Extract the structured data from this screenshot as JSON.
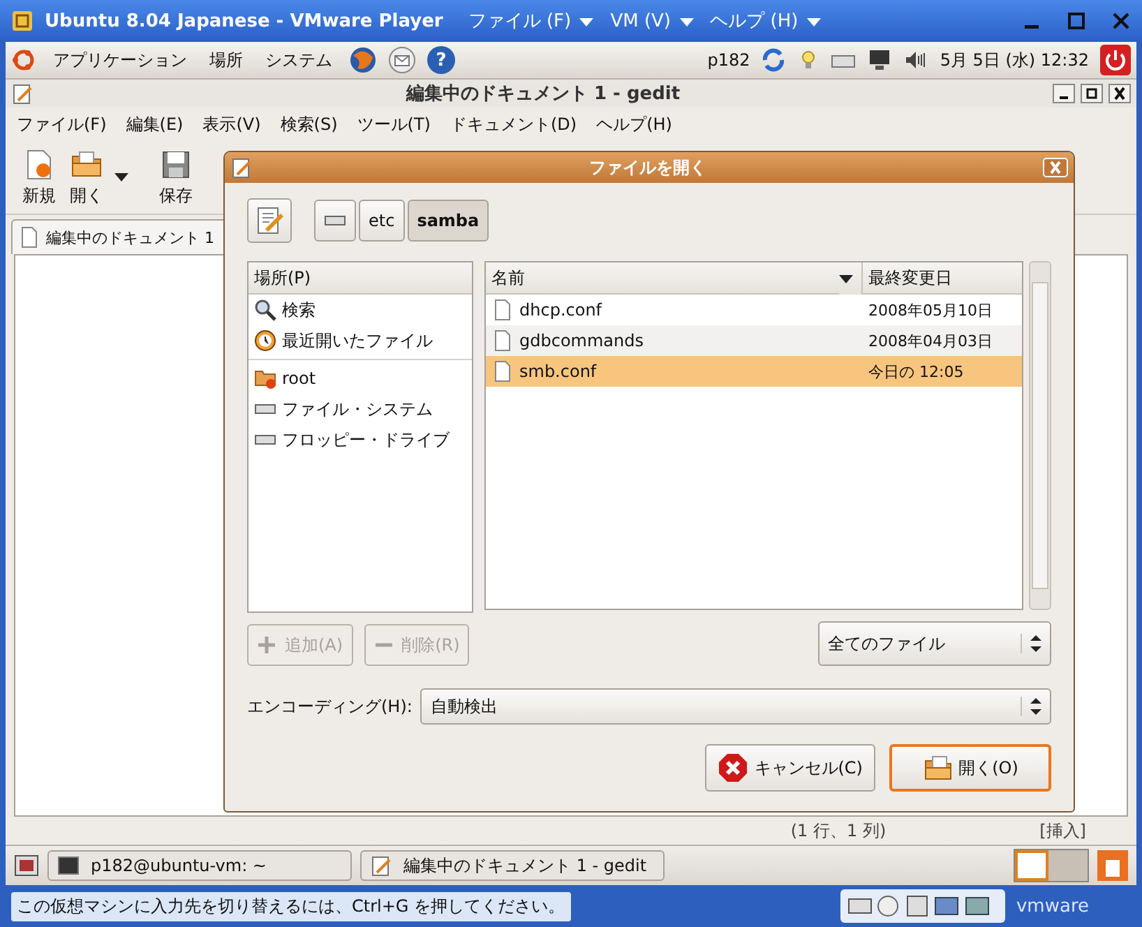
{
  "vm_window": {
    "title": "Ubuntu 8.04 Japanese - VMware Player",
    "menus": [
      "ファイル (F)",
      "VM (V)",
      "ヘルプ (H)"
    ]
  },
  "top_panel": {
    "menus": [
      "アプリケーション",
      "場所",
      "システム"
    ],
    "help_glyph": "?",
    "user": "p182",
    "clock": "5月 5日 (水) 12:32"
  },
  "gedit": {
    "title": "編集中のドキュメント 1 - gedit",
    "menus": [
      "ファイル(F)",
      "編集(E)",
      "表示(V)",
      "検索(S)",
      "ツール(T)",
      "ドキュメント(D)",
      "ヘルプ(H)"
    ],
    "toolbar": [
      {
        "label": "新規",
        "kind": "new"
      },
      {
        "label": "開く",
        "kind": "open"
      },
      {
        "label": "保存",
        "kind": "save"
      }
    ],
    "tab": "編集中のドキュメント 1",
    "status": [
      "(1 行、1 列)",
      "[挿入]"
    ]
  },
  "dialog": {
    "title": "ファイルを開く",
    "path": [
      {
        "label": "etc",
        "selected": false
      },
      {
        "label": "samba",
        "selected": true
      }
    ],
    "places_header": "場所(P)",
    "places": [
      [
        {
          "label": "検索",
          "kind": "search"
        },
        {
          "label": "最近開いたファイル",
          "kind": "recent"
        }
      ],
      [
        {
          "label": "root",
          "kind": "home"
        },
        {
          "label": "ファイル・システム",
          "kind": "drive"
        },
        {
          "label": "フロッピー・ドライブ",
          "kind": "drive"
        }
      ]
    ],
    "columns": [
      "名前",
      "最終変更日"
    ],
    "files": [
      {
        "name": "dhcp.conf",
        "modified": "2008年05月10日",
        "selected": false
      },
      {
        "name": "gdbcommands",
        "modified": "2008年04月03日",
        "selected": false
      },
      {
        "name": "smb.conf",
        "modified": "今日の 12:05",
        "selected": true
      }
    ],
    "place_buttons": [
      {
        "label": "追加(A)",
        "kind": "add",
        "disabled": true
      },
      {
        "label": "削除(R)",
        "kind": "remove",
        "disabled": true
      }
    ],
    "filter": "全てのファイル",
    "encoding_label": "エンコーディング(H):",
    "encoding": "自動検出",
    "cancel": "キャンセル(C)",
    "open": "開く(O)"
  },
  "taskbar": [
    {
      "label": "p182@ubuntu-vm: ~",
      "kind": "terminal"
    },
    {
      "label": "編集中のドキュメント 1 - gedit",
      "kind": "editor"
    }
  ],
  "vm_status": {
    "message": "この仮想マシンに入力先を切り替えるには、Ctrl+G を押してください。",
    "logo": "vmware"
  }
}
